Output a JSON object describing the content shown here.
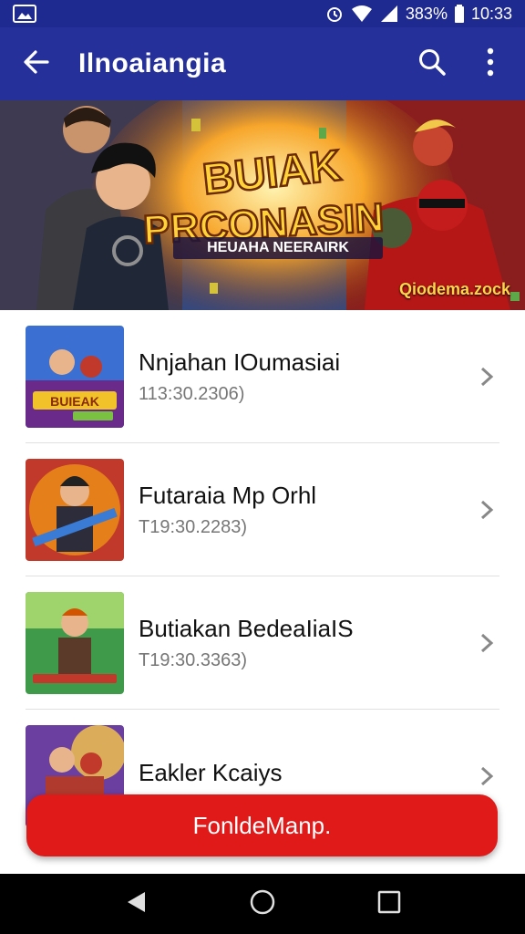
{
  "status_bar": {
    "battery": "383%",
    "time": "10:33",
    "icons": [
      "gallery-icon",
      "alarm-icon",
      "wifi-icon",
      "signal-icon",
      "battery-icon"
    ]
  },
  "app_bar": {
    "title": "Ilnoaiangia",
    "icons": [
      "back-arrow-icon",
      "search-icon",
      "more-vert-icon"
    ]
  },
  "banner": {
    "headline": "BUIAK PRCONASIN",
    "tagline": "HEUAHA NEERAIRK",
    "subtitle": "Qiodema.zock"
  },
  "list": {
    "items": [
      {
        "title": "Nnjahan IOumasiai",
        "subtitle": "113:30.2306)",
        "thumb_label": "BUIEAK"
      },
      {
        "title": "Futaraia Mp Orhl",
        "subtitle": "T19:30.2283)",
        "thumb_label": ""
      },
      {
        "title": "Butiakan BedeaIiaIS",
        "subtitle": "T19:30.3363)",
        "thumb_label": ""
      },
      {
        "title": "Eakler Kcaiys",
        "subtitle": "",
        "thumb_label": ""
      }
    ]
  },
  "action_button": {
    "label": "FonldeManp."
  },
  "nav_bar": {
    "icons": [
      "back-triangle-icon",
      "home-circle-icon",
      "recents-square-icon"
    ]
  },
  "colors": {
    "status_bar": "#1e2a8f",
    "app_bar": "#25309a",
    "accent_button": "#e01919",
    "nav_bar": "#000000"
  }
}
